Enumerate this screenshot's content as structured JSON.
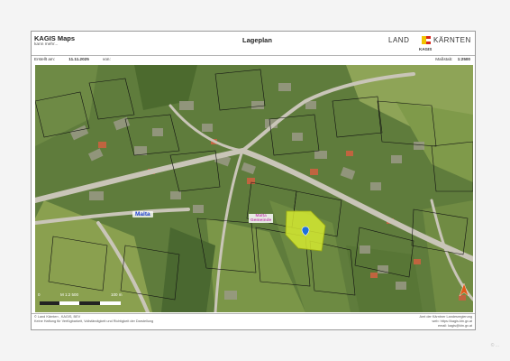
{
  "header": {
    "title": "KAGIS Maps",
    "subtitle": "kann mehr...",
    "center_title": "Lageplan",
    "brand_left": "LAND",
    "brand_right": "KÄRNTEN",
    "brand_sub": "KAGIS"
  },
  "meta": {
    "created_label": "Erstellt am:",
    "created_date": "11.11.2025",
    "by_label": "von:",
    "scale_label": "Maßstab:",
    "scale_value": "1:2500"
  },
  "map": {
    "road_label_1": "Malta",
    "road_label_2": "Malta",
    "road_label_2b": "Gemeinde",
    "scalebar_left": "0",
    "scalebar_mid": "M 1:2 500",
    "scalebar_right": "100 m",
    "colors": {
      "parcel_highlight": "#d4e830",
      "parcel_lines": "#111111",
      "road": "#c9c5b8",
      "label_blue": "#1d3fd0",
      "label_magenta": "#c64fb3"
    }
  },
  "footer": {
    "left_line1": "© Land Kärnten , KAGIS, BEV",
    "left_line2": "Keine Haftung für Verfügbarkeit, Vollständigkeit und Richtigkeit der Darstellung",
    "right_line1": "Amt der Kärntner Landesregierung",
    "right_line2": "web: https://kagis.ktn.gv.at",
    "right_line3": "email: kagis@ktn.gv.at"
  },
  "watermark": "© ..."
}
